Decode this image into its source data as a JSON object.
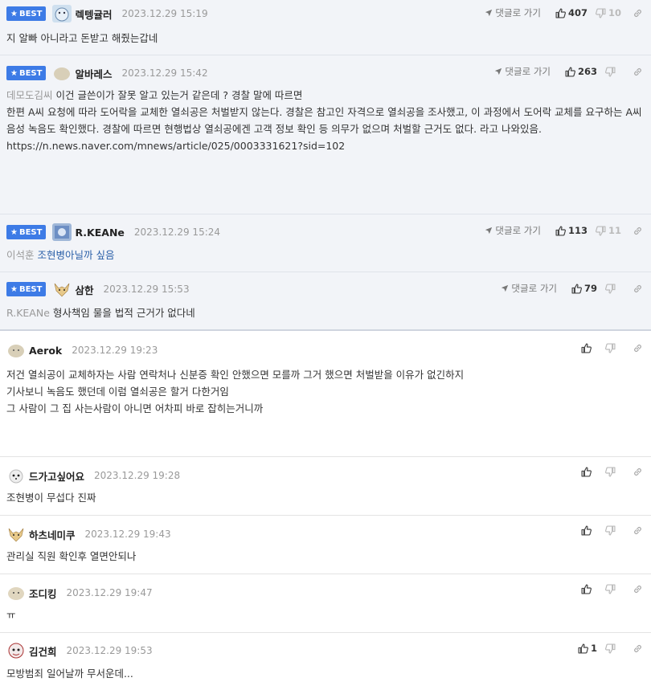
{
  "best_badge_label": "BEST",
  "reply_go_label": "댓글로 가기",
  "comments": [
    {
      "nick": "렉텡귤러",
      "date": "2023.12.29 15:19",
      "up": "407",
      "down": "10",
      "ref": "",
      "lines": [
        "지 알빠 아니라고 돈받고 해줬는갑네"
      ]
    },
    {
      "nick": "알바레스",
      "date": "2023.12.29 15:42",
      "up": "263",
      "down": "",
      "ref": "데모도김씨",
      "lines": [
        "이건 글쓴이가 잘못 알고 있는거 같은데 ? 경찰 말에 따르면",
        "한편 A씨 요청에 따라 도어락을 교체한 열쇠공은 처벌받지 않는다. 경찰은 참고인 자격으로 열쇠공을 조사했고, 이 과정에서 도어락 교체를 요구하는 A씨 음성 녹음도 확인했다. 경찰에 따르면 현행법상 열쇠공에겐 고객 정보 확인 등 의무가 없으며 처벌할 근거도 없다. 라고 나와있음.",
        "https://n.news.naver.com/mnews/article/025/0003331621?sid=102"
      ]
    },
    {
      "nick": "R.KEANe",
      "date": "2023.12.29 15:24",
      "up": "113",
      "down": "11",
      "ref": "이석훈",
      "lines": [
        "조현병아닐까 싶음"
      ]
    },
    {
      "nick": "삼한",
      "date": "2023.12.29 15:53",
      "up": "79",
      "down": "",
      "ref": "R.KEANe",
      "lines": [
        "형사책임 물을 법적 근거가 없다네"
      ]
    },
    {
      "nick": "Aerok",
      "date": "2023.12.29 19:23",
      "up": "",
      "down": "",
      "ref": "",
      "lines": [
        "저건 열쇠공이 교체하자는 사람 연락처나 신분증 확인 안했으면 모를까 그거 했으면 처벌받을 이유가 없긴하지",
        "기사보니 녹음도 했던데 이럼 열쇠공은 할거 다한거임",
        "그 사람이 그 집 사는사람이 아니면 어차피 바로 잡히는거니까"
      ]
    },
    {
      "nick": "드가고싶어요",
      "date": "2023.12.29 19:28",
      "up": "",
      "down": "",
      "ref": "",
      "lines": [
        "조현병이 무섭다 진짜"
      ]
    },
    {
      "nick": "하츠네미쿠",
      "date": "2023.12.29 19:43",
      "up": "",
      "down": "",
      "ref": "",
      "lines": [
        "관리실 직원 확인후 열면안되나"
      ]
    },
    {
      "nick": "조디킹",
      "date": "2023.12.29 19:47",
      "up": "",
      "down": "",
      "ref": "",
      "lines": [
        "ㅠ"
      ]
    },
    {
      "nick": "김건희",
      "date": "2023.12.29 19:53",
      "up": "1",
      "down": "",
      "ref": "",
      "lines": [
        "모방범죄 일어날까 무서운데..."
      ]
    }
  ]
}
